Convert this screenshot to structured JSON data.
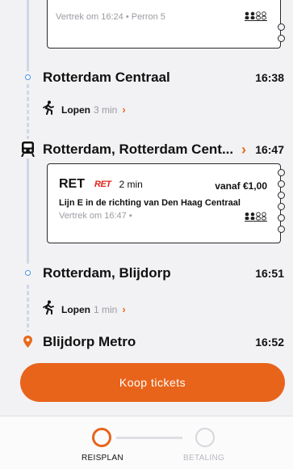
{
  "top_card": {
    "depart_text": "Vertrek om 16:24 • Perron 5"
  },
  "stops": [
    {
      "name": "Rotterdam Centraal",
      "time": "16:38"
    },
    {
      "name": "Rotterdam, Rotterdam Cent...",
      "time": "16:47"
    },
    {
      "name": "Rotterdam, Blijdorp",
      "time": "16:51"
    },
    {
      "name": "Blijdorp Metro",
      "time": "16:52"
    }
  ],
  "walks": [
    {
      "label": "Lopen",
      "duration": "3 min"
    },
    {
      "label": "Lopen",
      "duration": "1 min"
    }
  ],
  "ret_card": {
    "operator": "RET",
    "logo_text": "RET",
    "duration": "2 min",
    "price": "vanaf €1,00",
    "line": "Lijn E in de richting van Den Haag Centraal",
    "depart_text": "Vertrek om 16:47 •"
  },
  "cta": {
    "label": "Koop tickets"
  },
  "steps": [
    {
      "label": "REISPLAN",
      "active": true
    },
    {
      "label": "BETALING",
      "active": false
    }
  ],
  "colors": {
    "accent": "#e8641b",
    "stop_blue": "#4a90e2",
    "destination": "#e8691d",
    "ret_red": "#e2231a"
  }
}
